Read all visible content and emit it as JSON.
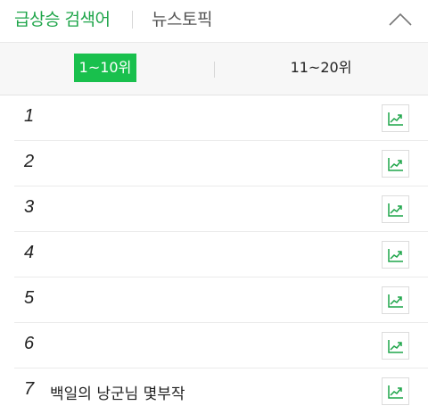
{
  "header": {
    "tab_rising": "급상승 검색어",
    "tab_news": "뉴스토픽"
  },
  "range_tabs": [
    {
      "label": "1~10위",
      "selected": true
    },
    {
      "label": "11~20위",
      "selected": false
    }
  ],
  "colors": {
    "accent_green": "#19c04d",
    "text_green": "#1fa54a"
  },
  "ranks": [
    {
      "num": "1",
      "keyword": ""
    },
    {
      "num": "2",
      "keyword": ""
    },
    {
      "num": "3",
      "keyword": ""
    },
    {
      "num": "4",
      "keyword": ""
    },
    {
      "num": "5",
      "keyword": ""
    },
    {
      "num": "6",
      "keyword": ""
    },
    {
      "num": "7",
      "keyword": "백일의 낭군님 몇부작"
    }
  ],
  "icons": {
    "collapse": "chevron-up-icon",
    "trend": "trend-chart-icon"
  }
}
